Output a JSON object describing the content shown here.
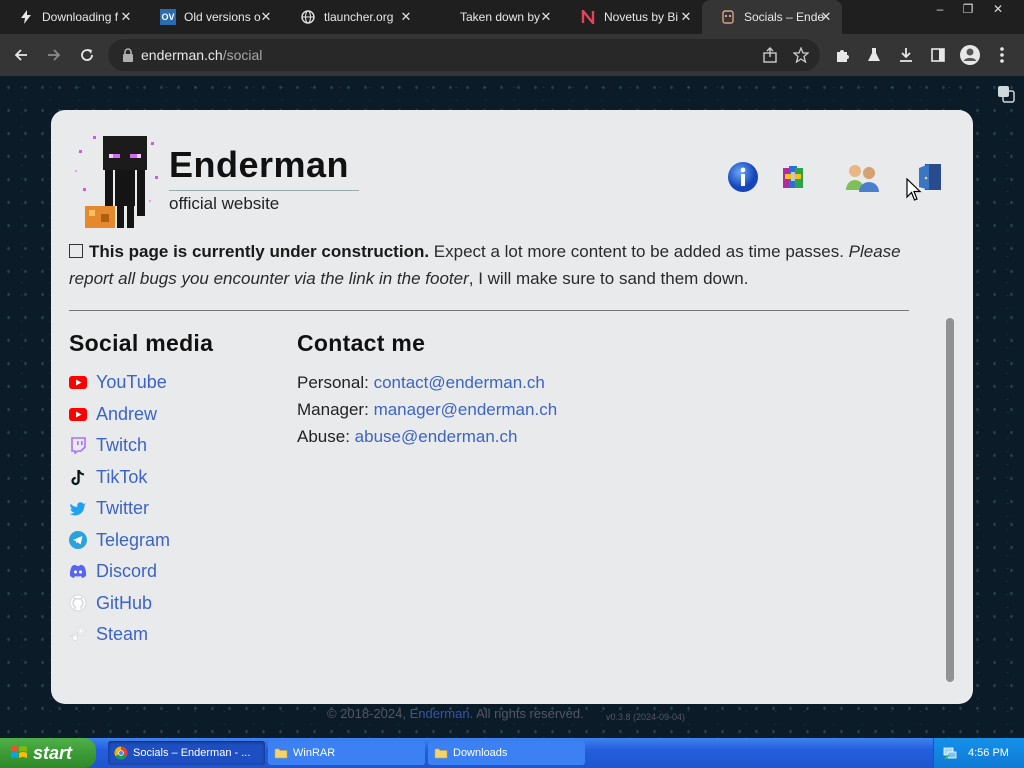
{
  "browser": {
    "tabs": [
      {
        "title": "Downloading f",
        "icon": "lightning-icon",
        "active": false
      },
      {
        "title": "Old versions o",
        "icon": "ov-logo-icon",
        "active": false
      },
      {
        "title": "tlauncher.org",
        "icon": "globe-icon",
        "active": false
      },
      {
        "title": "Taken down by",
        "icon": "",
        "active": false
      },
      {
        "title": "Novetus by Bi",
        "icon": "novetus-icon",
        "active": false
      },
      {
        "title": "Socials – Ende",
        "icon": "enderman-favicon",
        "active": true
      }
    ],
    "url_host": "enderman.ch",
    "url_path": "/social",
    "window_controls": [
      "–",
      "❐",
      "✕"
    ]
  },
  "site": {
    "name": "Enderman",
    "subtitle": "official website",
    "header_icons": [
      "info-icon",
      "archive-icon",
      "users-icon",
      "exit-door-icon"
    ]
  },
  "notice": {
    "bold": "This page is currently under construction.",
    "text": " Expect a lot more content to be added as time passes. ",
    "italic": "Please report all bugs you encounter via the link in the footer",
    "tail": ", I will make sure to sand them down."
  },
  "social": {
    "heading": "Social media",
    "items": [
      {
        "label": "YouTube",
        "icon": "youtube-icon",
        "color": "#ff0000"
      },
      {
        "label": "Andrew",
        "icon": "youtube-icon",
        "color": "#ff0000"
      },
      {
        "label": "Twitch",
        "icon": "twitch-icon",
        "color": "#a970ff"
      },
      {
        "label": "TikTok",
        "icon": "tiktok-icon",
        "color": "#000000"
      },
      {
        "label": "Twitter",
        "icon": "twitter-icon",
        "color": "#1da1f2"
      },
      {
        "label": "Telegram",
        "icon": "telegram-icon",
        "color": "#2aa3dd"
      },
      {
        "label": "Discord",
        "icon": "discord-icon",
        "color": "#5865f2"
      },
      {
        "label": "GitHub",
        "icon": "github-icon",
        "color": "#ffffff"
      },
      {
        "label": "Steam",
        "icon": "steam-icon",
        "color": "#ffffff"
      }
    ]
  },
  "contact": {
    "heading": "Contact me",
    "rows": [
      {
        "label": "Personal:",
        "email": "contact@enderman.ch"
      },
      {
        "label": "Manager:",
        "email": "manager@enderman.ch"
      },
      {
        "label": "Abuse:",
        "email": "abuse@enderman.ch"
      }
    ]
  },
  "footer": {
    "prefix": "© 2018-2024,",
    "link": "Enderman",
    "suffix": ". All rights reserved.",
    "version": "v0.3.8 (2024-09-04)"
  },
  "taskbar": {
    "start_label": "start",
    "tasks": [
      {
        "label": "Socials – Enderman - ...",
        "icon": "chrome-icon"
      },
      {
        "label": "WinRAR",
        "icon": "folder-icon"
      },
      {
        "label": "Downloads",
        "icon": "folder-icon"
      }
    ],
    "clock": "4:56 PM"
  },
  "colors": {
    "link": "#3b64c4",
    "card_bg": "#e9eaec",
    "taskbar_blue": "#245edb",
    "start_green": "#3c9b36"
  }
}
